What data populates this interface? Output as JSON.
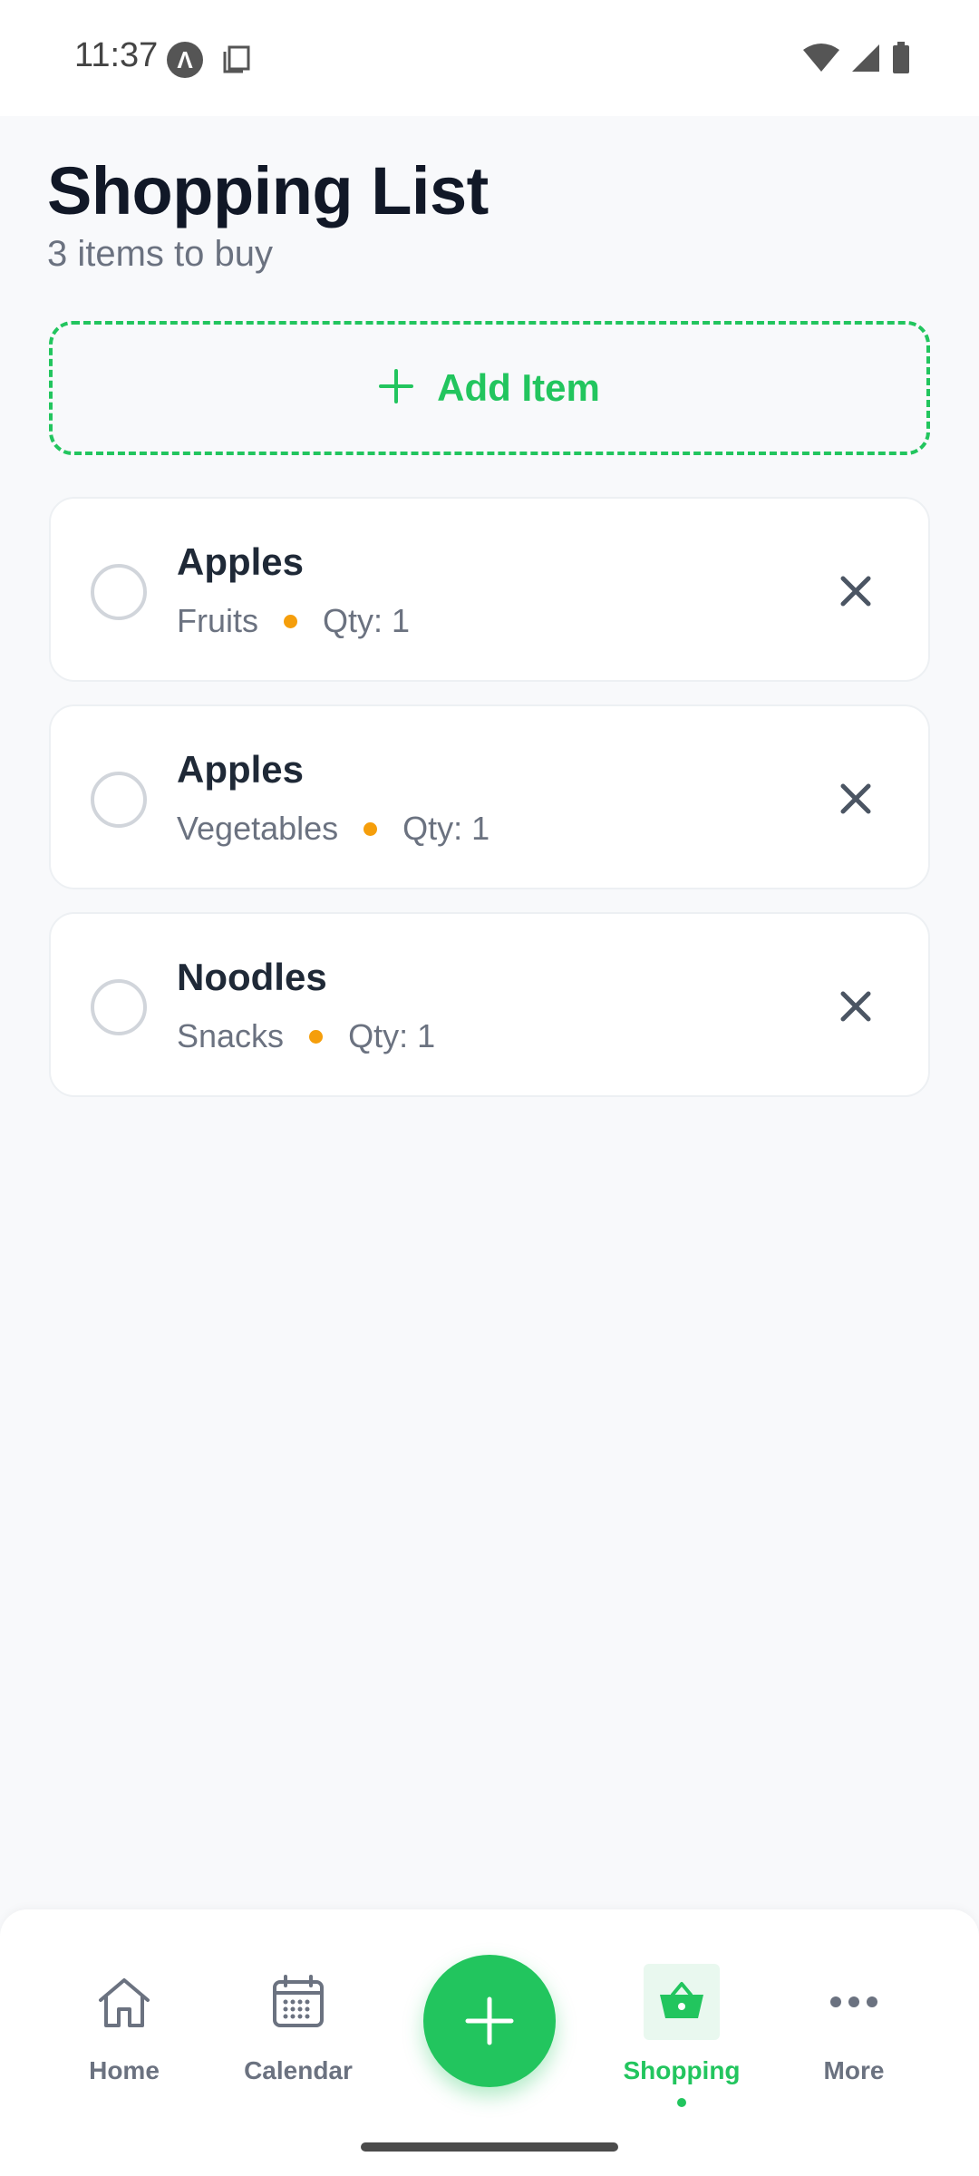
{
  "status_bar": {
    "time": "11:37"
  },
  "header": {
    "title": "Shopping List",
    "subtitle": "3 items to buy"
  },
  "add_button": {
    "label": "Add Item"
  },
  "items": [
    {
      "name": "Apples",
      "category": "Fruits",
      "qty": "Qty: 1"
    },
    {
      "name": "Apples",
      "category": "Vegetables",
      "qty": "Qty: 1"
    },
    {
      "name": "Noodles",
      "category": "Snacks",
      "qty": "Qty: 1"
    }
  ],
  "bottom_nav": {
    "items": [
      {
        "label": "Home",
        "icon": "home-icon"
      },
      {
        "label": "Calendar",
        "icon": "calendar-icon"
      },
      {
        "label": "Shopping",
        "icon": "basket-icon",
        "active": true
      },
      {
        "label": "More",
        "icon": "more-icon"
      }
    ]
  },
  "colors": {
    "accent": "#22c55e",
    "dot": "#f59e0b",
    "text": "#111827",
    "muted": "#6b7280"
  }
}
